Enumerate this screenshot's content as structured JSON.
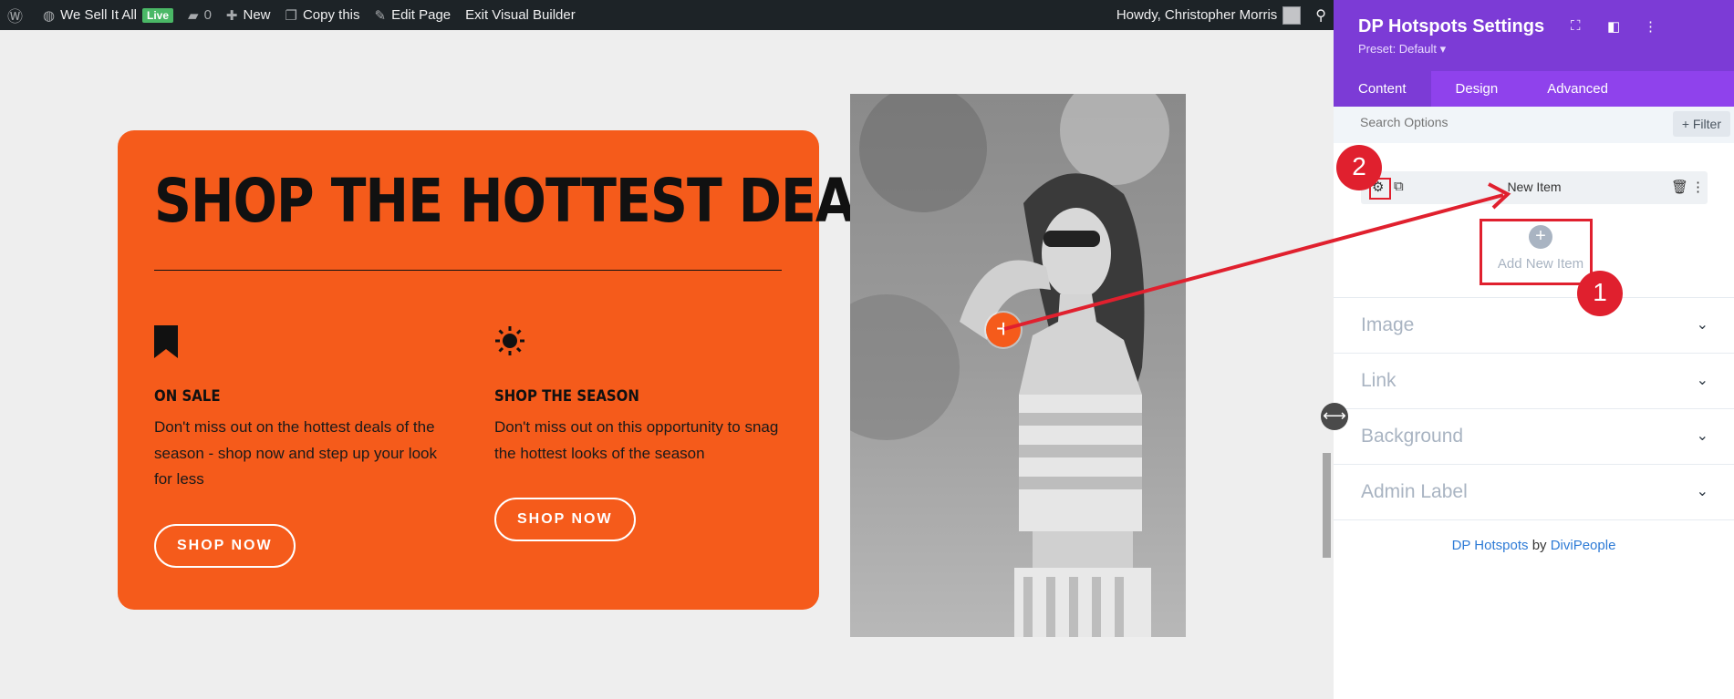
{
  "adminbar": {
    "site_name": "We Sell It All",
    "live_badge": "Live",
    "comments_count": "0",
    "new_label": "New",
    "copy_label": "Copy this",
    "edit_label": "Edit Page",
    "exit_label": "Exit Visual Builder",
    "greeting": "Howdy, Christopher Morris"
  },
  "card": {
    "title": "SHOP THE HOTTEST DEALS",
    "features": [
      {
        "icon": "bookmark-icon",
        "heading": "ON SALE",
        "text": "Don't miss out on the hottest deals of the season - shop now and step up your look for less",
        "button": "SHOP NOW"
      },
      {
        "icon": "sun-icon",
        "heading": "SHOP THE SEASON",
        "text": "Don't miss out on this opportunity to snag the hottest looks of the season",
        "button": "SHOP NOW"
      }
    ]
  },
  "panel": {
    "title": "DP Hotspots Settings",
    "preset": "Preset: Default ▾",
    "tabs": [
      "Content",
      "Design",
      "Advanced"
    ],
    "search_placeholder": "Search Options",
    "filter_label": "+ Filter",
    "item_label": "New Item",
    "add_new_label": "Add New Item",
    "sections": [
      "Image",
      "Link",
      "Background",
      "Admin Label"
    ],
    "footer": {
      "product": "DP Hotspots",
      "by": "by",
      "vendor": "DiviPeople"
    }
  },
  "annotations": {
    "badge1": "1",
    "badge2": "2"
  },
  "colors": {
    "accent": "#f55b1b",
    "panel_purple": "#7c3bd6",
    "annotation_red": "#e0202e"
  }
}
